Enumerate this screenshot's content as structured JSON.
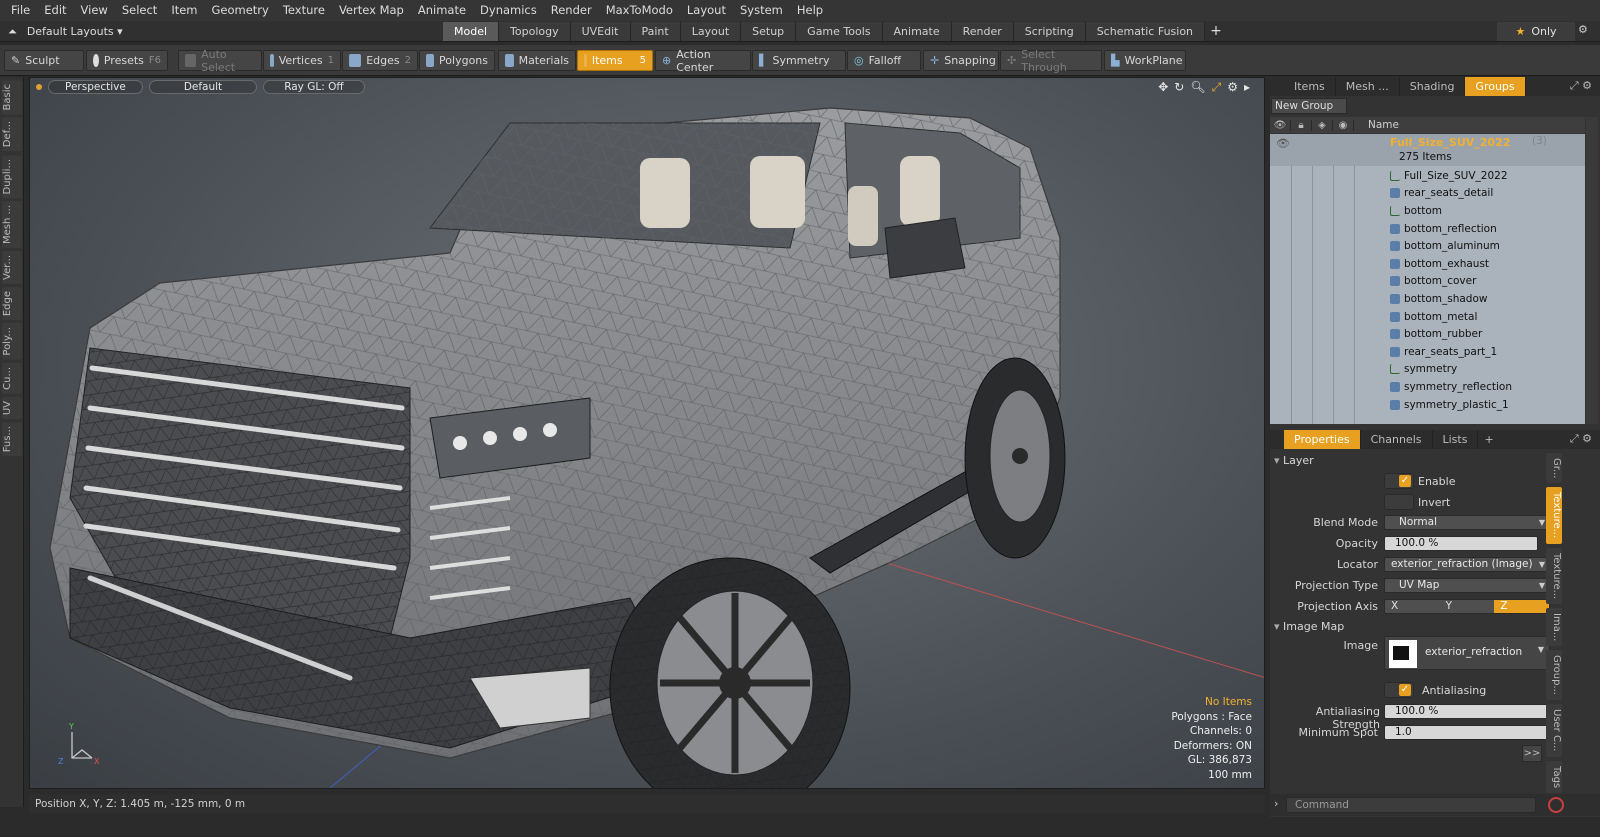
{
  "menubar": [
    "File",
    "Edit",
    "View",
    "Select",
    "Item",
    "Geometry",
    "Texture",
    "Vertex Map",
    "Animate",
    "Dynamics",
    "Render",
    "MaxToModo",
    "Layout",
    "System",
    "Help"
  ],
  "layouts": {
    "selector": "Default Layouts ▾"
  },
  "tabs": [
    "Model",
    "Topology",
    "UVEdit",
    "Paint",
    "Layout",
    "Setup",
    "Game Tools",
    "Animate",
    "Render",
    "Scripting",
    "Schematic Fusion"
  ],
  "tabs_active": "Model",
  "only_label": "Only",
  "toolbar": {
    "sculpt": "Sculpt",
    "presets": "Presets",
    "presets_key": "F6",
    "auto_select": "Auto Select",
    "vertices": "Vertices",
    "vertices_key": "1",
    "edges": "Edges",
    "edges_key": "2",
    "polygons": "Polygons",
    "materials": "Materials",
    "items": "Items",
    "items_key": "5",
    "action_center": "Action Center",
    "symmetry": "Symmetry",
    "falloff": "Falloff",
    "snapping": "Snapping",
    "select_through": "Select Through",
    "workplane": "WorkPlane"
  },
  "lefttabs": [
    "Basic",
    "Def...",
    "Dupli...",
    "Mesh ...",
    "Ver...",
    "Edge",
    "Poly...",
    "Cu...",
    "UV",
    "Fus..."
  ],
  "viewport": {
    "view": "Perspective",
    "shading": "Default",
    "raygl": "Ray GL: Off",
    "info": {
      "items": "No Items",
      "polygons": "Polygons : Face",
      "channels": "Channels: 0",
      "deformers": "Deformers: ON",
      "gl": "GL: 386,873",
      "scale": "100 mm"
    }
  },
  "status": {
    "position": "Position X, Y, Z:   1.405 m, -125 mm, 0 m"
  },
  "itemtabs": [
    "Items",
    "Mesh ...",
    "Shading",
    "Groups"
  ],
  "itemtabs_active": "Groups",
  "new_group": "New Group",
  "list_header": {
    "name": "Name"
  },
  "root": {
    "name": "Full_Size_SUV_2022",
    "count": "(3)",
    "sub": "275 Items"
  },
  "items": [
    {
      "name": "Full_Size_SUV_2022",
      "type": "locator"
    },
    {
      "name": "rear_seats_detail",
      "type": "mesh"
    },
    {
      "name": "bottom",
      "type": "locator"
    },
    {
      "name": "bottom_reflection",
      "type": "mesh"
    },
    {
      "name": "bottom_aluminum",
      "type": "mesh"
    },
    {
      "name": "bottom_exhaust",
      "type": "mesh"
    },
    {
      "name": "bottom_cover",
      "type": "mesh"
    },
    {
      "name": "bottom_shadow",
      "type": "mesh"
    },
    {
      "name": "bottom_metal",
      "type": "mesh"
    },
    {
      "name": "bottom_rubber",
      "type": "mesh"
    },
    {
      "name": "rear_seats_part_1",
      "type": "mesh"
    },
    {
      "name": "symmetry",
      "type": "locator"
    },
    {
      "name": "symmetry_reflection",
      "type": "mesh"
    },
    {
      "name": "symmetry_plastic_1",
      "type": "mesh"
    }
  ],
  "proptabs": [
    "Properties",
    "Channels",
    "Lists"
  ],
  "proptabs_active": "Properties",
  "props": {
    "layer_section": "Layer",
    "enable": "Enable",
    "invert": "Invert",
    "blend_mode_label": "Blend Mode",
    "blend_mode": "Normal",
    "opacity_label": "Opacity",
    "opacity": "100.0 %",
    "locator_label": "Locator",
    "locator": "exterior_refraction (Image) (...",
    "projection_type_label": "Projection Type",
    "projection_type": "UV Map",
    "projection_axis_label": "Projection Axis",
    "axis_x": "X",
    "axis_y": "Y",
    "axis_z": "Z",
    "image_map_section": "Image Map",
    "image_label": "Image",
    "image": "exterior_refraction",
    "antialiasing": "Antialiasing",
    "aa_strength_label": "Antialiasing Strength",
    "aa_strength": "100.0 %",
    "min_spot_label": "Minimum Spot",
    "min_spot": "1.0",
    "more": ">>"
  },
  "vtabs": [
    "Gr...",
    "Texture...",
    "Texture...",
    "Ima...",
    "Group...",
    "User C...",
    "Tags"
  ],
  "vtabs_active": 1,
  "command": {
    "placeholder": "Command"
  },
  "colors": {
    "accent": "#e8a020",
    "list_bg": "#aab2bb"
  }
}
